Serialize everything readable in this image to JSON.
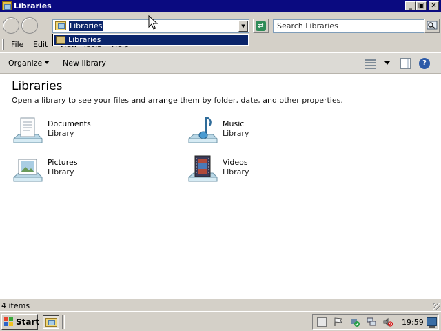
{
  "window": {
    "title": "Libraries",
    "controls": {
      "minimize": "_",
      "maximize": "▣",
      "close": "✕"
    }
  },
  "address": {
    "value": "Libraries",
    "dropdown_items": [
      "Libraries"
    ]
  },
  "search": {
    "placeholder": "Search Libraries"
  },
  "menu": [
    "File",
    "Edit",
    "View",
    "Tools",
    "Help"
  ],
  "commands": {
    "organize": "Organize",
    "new_library": "New library"
  },
  "content": {
    "heading": "Libraries",
    "subtitle": "Open a library to see your files and arrange them by folder, date, and other properties.",
    "libraries": [
      {
        "name": "Documents",
        "type": "Library",
        "icon": "documents-library-icon"
      },
      {
        "name": "Music",
        "type": "Library",
        "icon": "music-library-icon"
      },
      {
        "name": "Pictures",
        "type": "Library",
        "icon": "pictures-library-icon"
      },
      {
        "name": "Videos",
        "type": "Library",
        "icon": "videos-library-icon"
      }
    ]
  },
  "status": {
    "item_count": "4 items"
  },
  "taskbar": {
    "start_label": "Start",
    "clock": "19:59"
  },
  "colors": {
    "titlebar": "#0a0a80",
    "selection": "#0a246a",
    "chrome": "#d4d0c8"
  }
}
